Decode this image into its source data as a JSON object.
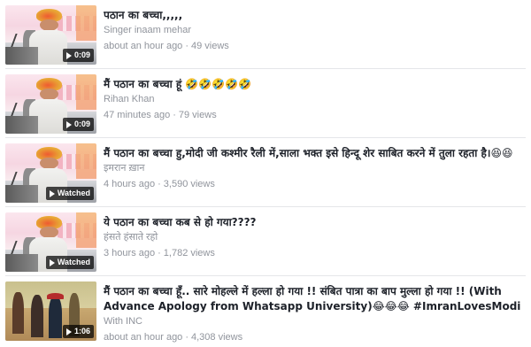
{
  "videos": [
    {
      "title": "पठान का बच्चा,,,,,",
      "author": "Singer inaam mehar",
      "time": "about an hour ago",
      "views": "49 views",
      "badge": "0:09",
      "badge_icon": "play-icon"
    },
    {
      "title": "मैं पठान का बच्चा हूं 🤣🤣🤣🤣🤣",
      "author": "Rihan Khan",
      "time": "47 minutes ago",
      "views": "79 views",
      "badge": "0:09",
      "badge_icon": "play-icon"
    },
    {
      "title": "मैं पठान का बच्चा हु,मोदी जी कश्मीर रैली में,साला भक्त इसे हिन्दू शेर साबित करने में तुला रहता है।😆😆",
      "author": "इमरान ख़ान",
      "time": "4 hours ago",
      "views": "3,590 views",
      "badge": "Watched",
      "badge_icon": "play-icon"
    },
    {
      "title": "ये पठान का बच्चा कब से हो गया????",
      "author": "हंसते हंसाते रहो",
      "time": "3 hours ago",
      "views": "1,782 views",
      "badge": "Watched",
      "badge_icon": "play-icon"
    },
    {
      "title": "मैं पठान का बच्चा हूँ.. सारे मोहल्ले में हल्ला हो गया !! संबित पात्रा का बाप मुल्ला हो गया !! (With Advance Apology from Whatsapp University)😂😂😂 #ImranLovesModi",
      "author": "With INC",
      "time": "about an hour ago",
      "views": "4,308 views",
      "badge": "1:06",
      "badge_icon": "play-icon"
    }
  ],
  "colors": {
    "title": "#1d2129",
    "secondary": "#90949c",
    "divider": "#e5e6e9",
    "badge_bg": "#000000"
  }
}
